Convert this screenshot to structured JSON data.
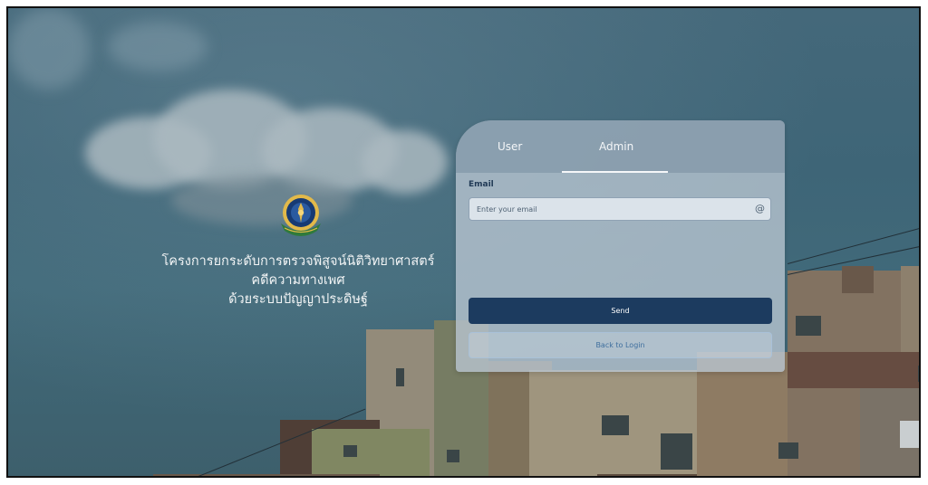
{
  "background": {
    "title_lines": [
      "โครงการยกระดับการตรวจพิสูจน์นิติวิทยาศาสตร์",
      "คดีความทางเพศ",
      "ด้วยระบบปัญญาประดิษฐ์"
    ],
    "logo_icon": "institution-emblem-icon"
  },
  "login": {
    "tabs": [
      {
        "label": "User"
      },
      {
        "label": "Admin"
      }
    ],
    "active_tab": "Admin",
    "email_label": "Email",
    "email_placeholder": "Enter your email",
    "email_icon": "at-icon",
    "send_label": "Send",
    "back_label": "Back to Login"
  },
  "colors": {
    "primary_button": "#1c3b5f",
    "link": "#3f6f9e"
  }
}
